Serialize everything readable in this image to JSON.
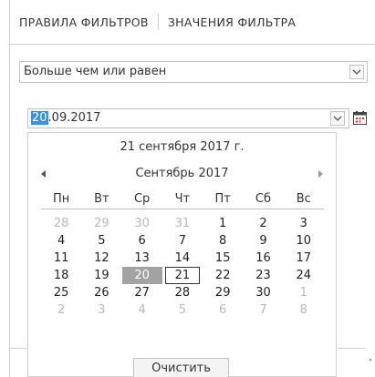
{
  "tabs": [
    {
      "label": "ПРАВИЛА ФИЛЬТРОВ"
    },
    {
      "label": "ЗНАЧЕНИЯ ФИЛЬТРА"
    }
  ],
  "condition": {
    "selected": "Больше чем или равен"
  },
  "date_input": {
    "day_selected": "20",
    "rest": ".09.2017"
  },
  "calendar": {
    "today_label": "21 сентября 2017 г.",
    "month_label": "Сентябрь 2017",
    "weekdays": [
      "Пн",
      "Вт",
      "Ср",
      "Чт",
      "Пт",
      "Сб",
      "Вс"
    ],
    "weeks": [
      [
        {
          "d": "28",
          "other": true
        },
        {
          "d": "29",
          "other": true
        },
        {
          "d": "30",
          "other": true
        },
        {
          "d": "31",
          "other": true
        },
        {
          "d": "1"
        },
        {
          "d": "2"
        },
        {
          "d": "3"
        }
      ],
      [
        {
          "d": "4"
        },
        {
          "d": "5"
        },
        {
          "d": "6"
        },
        {
          "d": "7"
        },
        {
          "d": "8"
        },
        {
          "d": "9"
        },
        {
          "d": "10"
        }
      ],
      [
        {
          "d": "11"
        },
        {
          "d": "12"
        },
        {
          "d": "13"
        },
        {
          "d": "14"
        },
        {
          "d": "15"
        },
        {
          "d": "16"
        },
        {
          "d": "17"
        }
      ],
      [
        {
          "d": "18"
        },
        {
          "d": "19"
        },
        {
          "d": "20",
          "selected": true
        },
        {
          "d": "21",
          "today": true
        },
        {
          "d": "22"
        },
        {
          "d": "23"
        },
        {
          "d": "24"
        }
      ],
      [
        {
          "d": "25"
        },
        {
          "d": "26"
        },
        {
          "d": "27"
        },
        {
          "d": "28"
        },
        {
          "d": "29"
        },
        {
          "d": "30"
        },
        {
          "d": "1",
          "other": true
        }
      ],
      [
        {
          "d": "2",
          "other": true
        },
        {
          "d": "3",
          "other": true
        },
        {
          "d": "4",
          "other": true
        },
        {
          "d": "5",
          "other": true
        },
        {
          "d": "6",
          "other": true
        },
        {
          "d": "7",
          "other": true
        },
        {
          "d": "8",
          "other": true
        }
      ]
    ],
    "clear_label": "Очистить"
  },
  "trailing_dot": ".",
  "colors": {
    "selection": "#3a8ee6",
    "selected_day": "#a3a3a3",
    "other_month": "#b8b8b8",
    "calendar_icon_red": "#d9342b"
  },
  "icons": {
    "dropdown": "chevron-down-icon",
    "calendar": "calendar-icon",
    "prev": "triangle-left-icon",
    "next": "triangle-right-icon"
  }
}
